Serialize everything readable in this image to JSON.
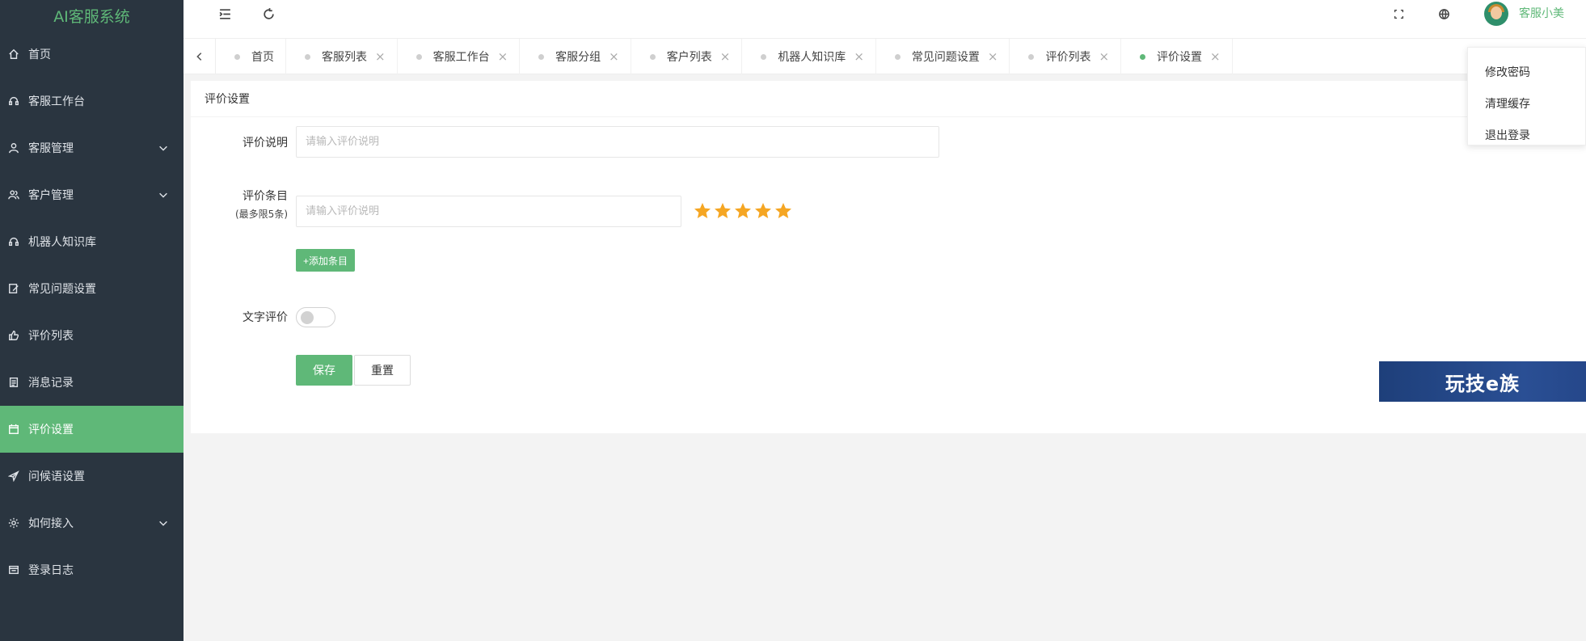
{
  "app": {
    "title": "AI客服系统",
    "accent_color": "#5fb878",
    "sidebar_bg": "#2a3540"
  },
  "sidebar": {
    "items": [
      {
        "label": "首页",
        "icon": "home-icon",
        "expandable": false,
        "active": false
      },
      {
        "label": "客服工作台",
        "icon": "headset-icon",
        "expandable": false,
        "active": false
      },
      {
        "label": "客服管理",
        "icon": "user-icon",
        "expandable": true,
        "active": false
      },
      {
        "label": "客户管理",
        "icon": "users-icon",
        "expandable": true,
        "active": false
      },
      {
        "label": "机器人知识库",
        "icon": "headset-icon",
        "expandable": false,
        "active": false
      },
      {
        "label": "常见问题设置",
        "icon": "edit-icon",
        "expandable": false,
        "active": false
      },
      {
        "label": "评价列表",
        "icon": "thumb-up-icon",
        "expandable": false,
        "active": false
      },
      {
        "label": "消息记录",
        "icon": "document-icon",
        "expandable": false,
        "active": false
      },
      {
        "label": "评价设置",
        "icon": "calendar-icon",
        "expandable": false,
        "active": true
      },
      {
        "label": "问候语设置",
        "icon": "send-icon",
        "expandable": false,
        "active": false
      },
      {
        "label": "如何接入",
        "icon": "gear-icon",
        "expandable": true,
        "active": false
      },
      {
        "label": "登录日志",
        "icon": "window-icon",
        "expandable": false,
        "active": false
      }
    ]
  },
  "header": {
    "icons": [
      "menu-toggle-icon",
      "refresh-icon",
      "fullscreen-icon",
      "globe-icon"
    ],
    "username": "客服小美"
  },
  "tabs": [
    {
      "label": "首页",
      "closable": false,
      "active": false
    },
    {
      "label": "客服列表",
      "closable": true,
      "active": false
    },
    {
      "label": "客服工作台",
      "closable": true,
      "active": false
    },
    {
      "label": "客服分组",
      "closable": true,
      "active": false
    },
    {
      "label": "客户列表",
      "closable": true,
      "active": false
    },
    {
      "label": "机器人知识库",
      "closable": true,
      "active": false
    },
    {
      "label": "常见问题设置",
      "closable": true,
      "active": false
    },
    {
      "label": "评价列表",
      "closable": true,
      "active": false
    },
    {
      "label": "评价设置",
      "closable": true,
      "active": true
    }
  ],
  "tab_close_glyph": "×",
  "card": {
    "title": "评价设置"
  },
  "form": {
    "desc_label": "评价说明",
    "desc_placeholder": "请输入评价说明",
    "items_label": "评价条目",
    "items_sublabel": "(最多限5条)",
    "items_placeholder": "请输入评价说明",
    "star_rating": 5,
    "add_button": "+添加条目",
    "text_label": "文字评价",
    "text_enabled": false,
    "save_button": "保存",
    "reset_button": "重置"
  },
  "dropdown": {
    "items": [
      "修改密码",
      "清理缓存",
      "退出登录"
    ]
  },
  "watermark": {
    "text": "玩技e族"
  }
}
